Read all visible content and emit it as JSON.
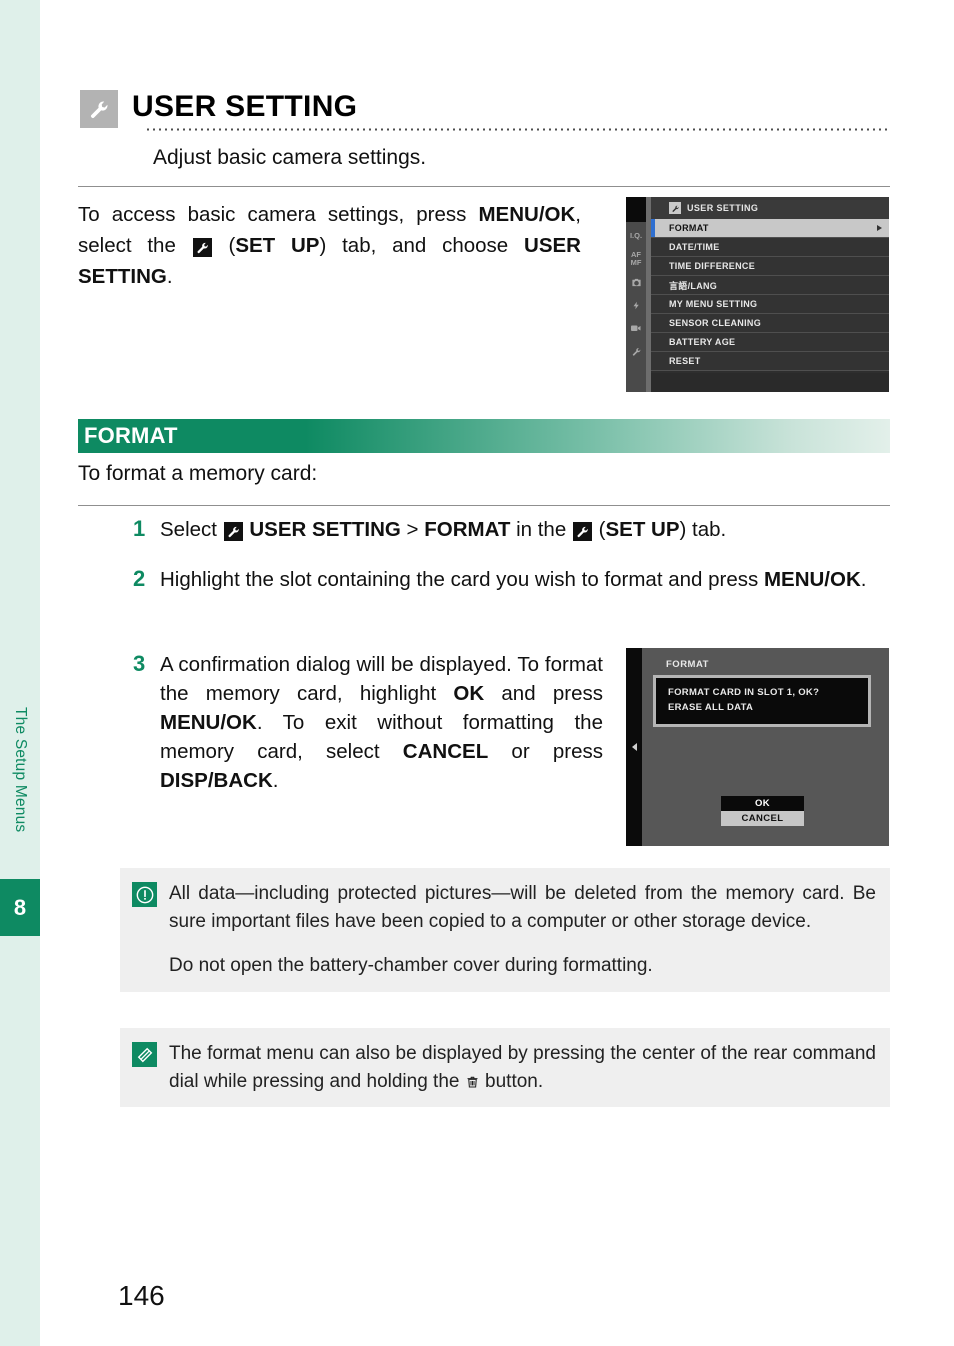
{
  "chapter_rail": {
    "label": "The Setup Menus",
    "tab_number": "8",
    "accent_color": "#0e8a62",
    "rail_color": "#dff0ea"
  },
  "header": {
    "icon": "wrench-icon",
    "title": "USER SETTING",
    "subtitle": "Adjust basic camera settings."
  },
  "intro": {
    "part1": "To access basic camera settings, press ",
    "menu_ok": "MENU/OK",
    "part2": ", select the ",
    "setup_icon": "wrench-icon",
    "part3": " (",
    "set_up": "SET UP",
    "part4": ") tab, and choose ",
    "user_setting": "USER SETTING",
    "part5": "."
  },
  "menu_screenshot": {
    "header_label": "USER SETTING",
    "header_icon": "wrench-icon",
    "tabs": [
      "I.Q.",
      "AF/MF",
      "camera-icon",
      "flash-icon",
      "movie-icon",
      "wrench-icon"
    ],
    "rows": [
      {
        "label": "FORMAT",
        "selected": true,
        "has_arrow": true
      },
      {
        "label": "DATE/TIME",
        "selected": false,
        "has_arrow": false
      },
      {
        "label": "TIME DIFFERENCE",
        "selected": false,
        "has_arrow": false
      },
      {
        "label": "言語/LANG",
        "selected": false,
        "has_arrow": false
      },
      {
        "label": "MY MENU SETTING",
        "selected": false,
        "has_arrow": false
      },
      {
        "label": "SENSOR CLEANING",
        "selected": false,
        "has_arrow": false
      },
      {
        "label": "BATTERY AGE",
        "selected": false,
        "has_arrow": false
      },
      {
        "label": "RESET",
        "selected": false,
        "has_arrow": false
      }
    ],
    "selection_bar_color": "#2f6fd0"
  },
  "format_section": {
    "bar_label": "FORMAT",
    "lead": "To format a memory card:",
    "bar_color": "#0e8a62"
  },
  "steps": [
    {
      "number": "1",
      "segments": [
        {
          "t": "Select ",
          "b": false
        },
        {
          "t": "ICON:wrench",
          "b": false
        },
        {
          "t": " USER SETTING",
          "b": true
        },
        {
          "t": " > ",
          "b": false
        },
        {
          "t": "FORMAT",
          "b": true
        },
        {
          "t": " in the ",
          "b": false
        },
        {
          "t": "ICON:wrench",
          "b": false
        },
        {
          "t": " (",
          "b": false
        },
        {
          "t": "SET UP",
          "b": true
        },
        {
          "t": ") tab.",
          "b": false
        }
      ]
    },
    {
      "number": "2",
      "segments": [
        {
          "t": "Highlight the slot containing the card you wish to format and press ",
          "b": false
        },
        {
          "t": "MENU/OK",
          "b": true
        },
        {
          "t": ".",
          "b": false
        }
      ]
    },
    {
      "number": "3",
      "segments": [
        {
          "t": "A confirmation dialog will be displayed. To format the memory card, highlight ",
          "b": false
        },
        {
          "t": "OK",
          "b": true
        },
        {
          "t": " and press ",
          "b": false
        },
        {
          "t": "MENU/OK",
          "b": true
        },
        {
          "t": ". To exit without formatting the memory card, select ",
          "b": false
        },
        {
          "t": "CANCEL",
          "b": true
        },
        {
          "t": " or press ",
          "b": false
        },
        {
          "t": "DISP/BACK",
          "b": true
        },
        {
          "t": ".",
          "b": false
        }
      ]
    }
  ],
  "dialog_screenshot": {
    "title": "FORMAT",
    "message_line1": "FORMAT CARD IN SLOT 1, OK?",
    "message_line2": "ERASE ALL DATA",
    "button_ok": "OK",
    "button_cancel": "CANCEL",
    "highlighted_button": "OK"
  },
  "notes": {
    "caution": {
      "icon": "caution-icon",
      "paragraph1": "All data—including protected pictures—will be deleted from the memory card. Be sure important files have been copied to a computer or other storage device.",
      "paragraph2": "Do not open the battery-chamber cover during formatting."
    },
    "tip": {
      "icon": "note-pen-icon",
      "text_before": "The format menu can also be displayed by pressing the center of the rear command dial while pressing and holding the ",
      "inline_icon": "trash-icon",
      "text_after": " button."
    }
  },
  "page_number": "146"
}
